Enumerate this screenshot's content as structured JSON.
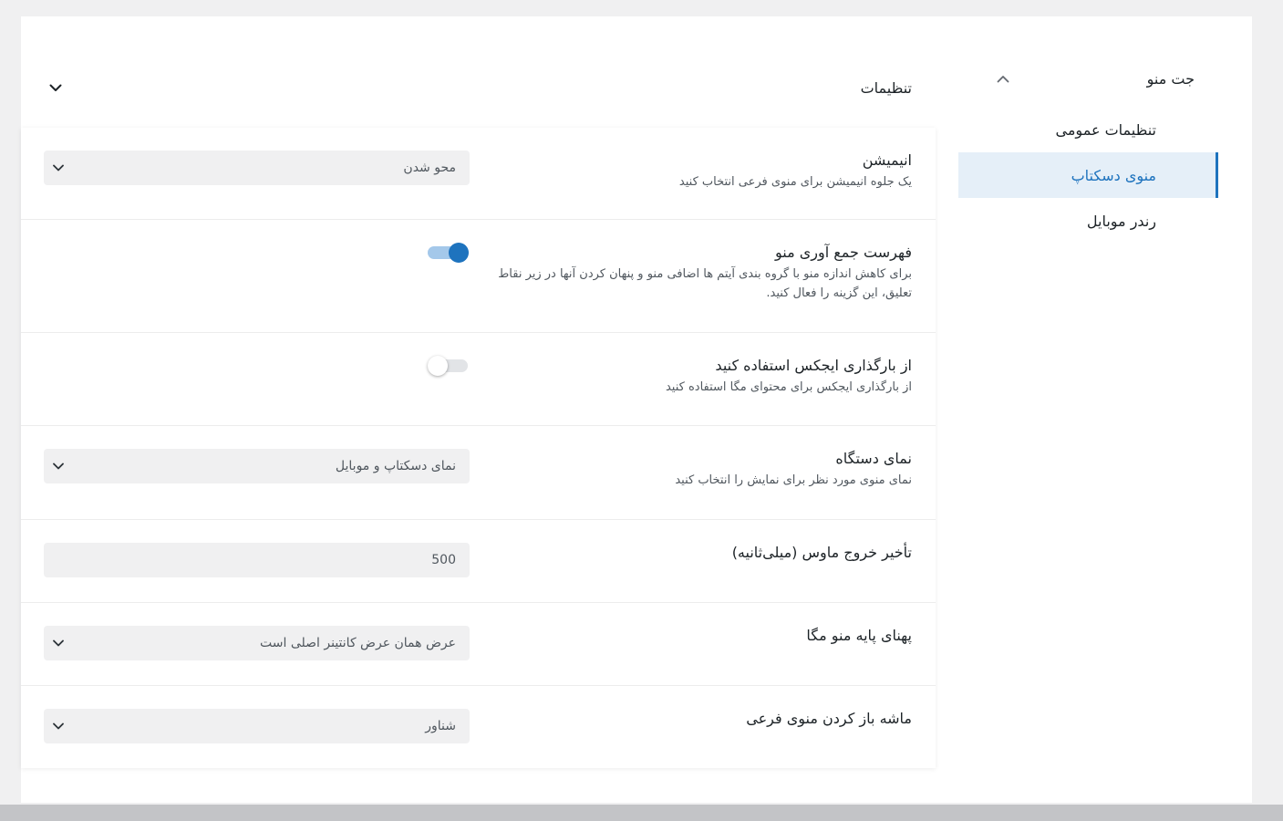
{
  "theme": {
    "accent": "#1e73be",
    "accent_soft": "#e5eff8",
    "toggle_track_on": "#a4c8ea"
  },
  "sidebar": {
    "title": "جت منو",
    "collapse_icon": "chevron-up-icon",
    "items": [
      {
        "label": "تنظیمات عمومی",
        "active": false
      },
      {
        "label": "منوی دسکتاپ",
        "active": true
      },
      {
        "label": "رندر موبایل",
        "active": false
      }
    ]
  },
  "panel": {
    "title": "تنظیمات",
    "expand_icon": "chevron-down-icon"
  },
  "select_icon": "chevron-down-icon",
  "settings": [
    {
      "title": "انیمیشن",
      "description": "یک جلوه انیمیشن برای منوی فرعی انتخاب کنید",
      "value": "محو شدن"
    },
    {
      "title": "فهرست جمع آوری منو",
      "description": "برای کاهش اندازه منو با گروه بندی آیتم ها اضافی منو و پنهان کردن آنها در زیر نقاط تعلیق، این گزینه را فعال کنید.",
      "enabled": true
    },
    {
      "title": "از بارگذاری ایجکس استفاده کنید",
      "description": "از بارگذاری ایجکس برای محتوای مگا استفاده کنید",
      "enabled": false
    },
    {
      "title": "نمای دستگاه",
      "description": "نمای منوی مورد نظر برای نمایش را انتخاب کنید",
      "value": "نمای دسکتاپ و موبایل"
    },
    {
      "title": "تأخیر خروج ماوس (میلی‌ثانیه)",
      "value": "500"
    },
    {
      "title": "پهنای پایه منو مگا",
      "value": "عرض همان عرض کانتینر اصلی است"
    },
    {
      "title": "ماشه باز کردن منوی فرعی",
      "value": "شناور"
    }
  ]
}
